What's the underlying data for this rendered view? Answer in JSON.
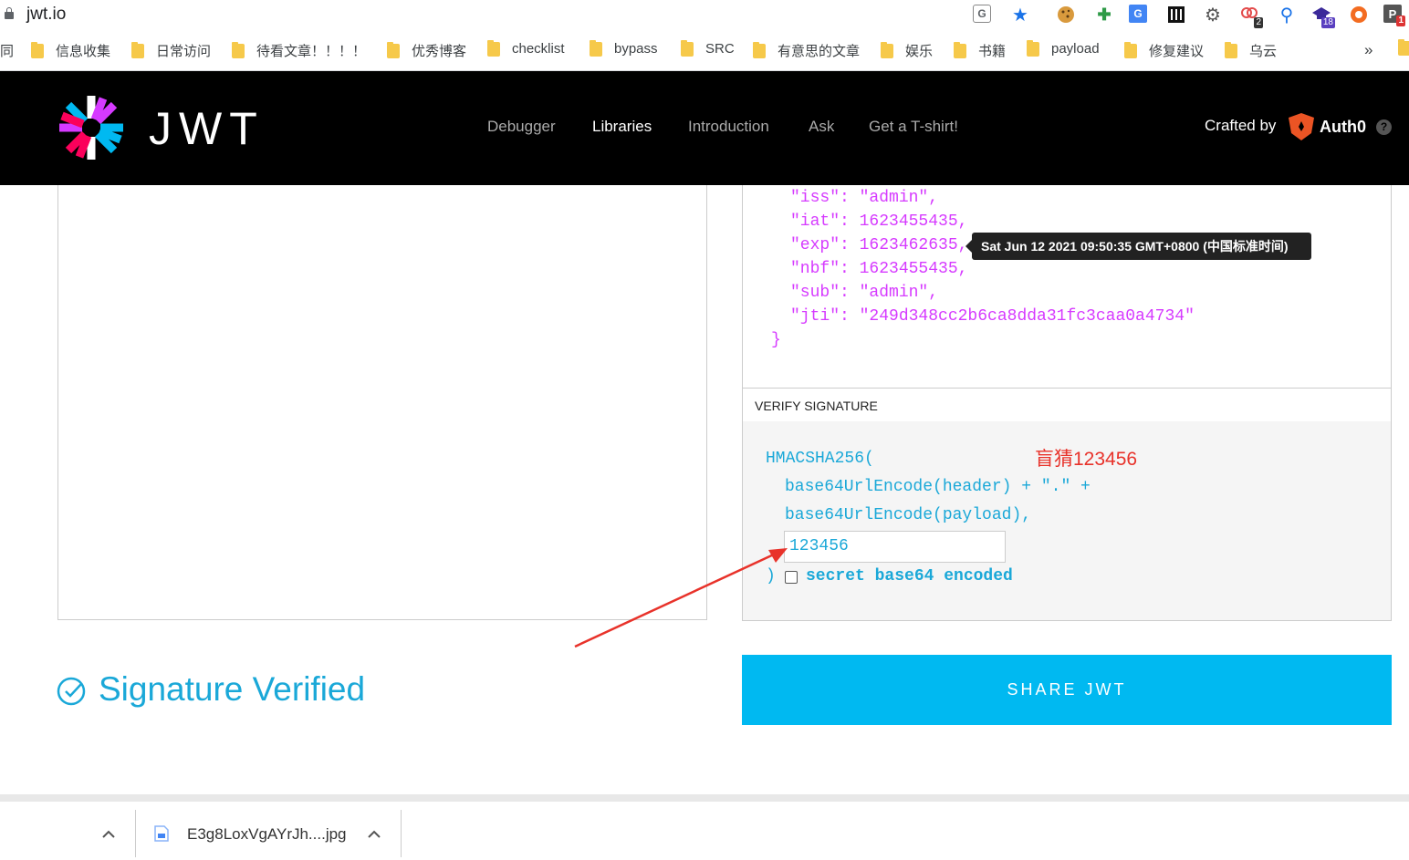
{
  "browser": {
    "url": "jwt.io",
    "extensions": [
      {
        "name": "translate-icon",
        "glyph": "G"
      },
      {
        "name": "star-icon",
        "glyph": "★"
      },
      {
        "name": "cookie-icon",
        "glyph": "🍪"
      },
      {
        "name": "plus-extension-icon",
        "glyph": "✚"
      },
      {
        "name": "google-translate-icon",
        "glyph": "G"
      },
      {
        "name": "columns-icon",
        "glyph": "▥"
      },
      {
        "name": "gear-extension-icon",
        "glyph": "⚙"
      },
      {
        "name": "links-extension-icon",
        "glyph": "∞",
        "badge": "2"
      },
      {
        "name": "pin-icon",
        "glyph": "⚲"
      },
      {
        "name": "cap-extension-icon",
        "glyph": "▲",
        "badge": "18"
      },
      {
        "name": "lifebuoy-icon",
        "glyph": "◎"
      },
      {
        "name": "p-extension-icon",
        "glyph": "P",
        "badge": "1"
      }
    ],
    "bookmarks": [
      "信息收集",
      "日常访问",
      "待看文章！！！！",
      "优秀博客",
      "checklist",
      "bypass",
      "SRC",
      "有意思的文章",
      "娱乐",
      "书籍",
      "payload",
      "修复建议",
      "乌云"
    ],
    "bookmark_partial": "同",
    "more": "»"
  },
  "header": {
    "logo_text": "JWT",
    "nav": [
      "Debugger",
      "Libraries",
      "Introduction",
      "Ask",
      "Get a T-shirt!"
    ],
    "crafted_by": "Crafted by",
    "auth0": "Auth0",
    "help": "?"
  },
  "payload": {
    "lines": [
      "\"iss\": \"admin\",",
      "\"iat\": 1623455435,",
      "\"exp\": 1623462635,",
      "\"nbf\": 1623455435,",
      "\"sub\": \"admin\",",
      "\"jti\": \"249d348cc2b6ca8dda31fc3caa0a4734\""
    ],
    "closing": "}",
    "tooltip": "Sat Jun 12 2021 09:50:35 GMT+0800 (中国标准时间)"
  },
  "verify": {
    "heading": "VERIFY SIGNATURE",
    "fn": "HMACSHA256(",
    "line2": "base64UrlEncode(header) + \".\" +",
    "line3": "base64UrlEncode(payload),",
    "secret": "123456",
    "close": ")",
    "b64_label": "secret base64 encoded",
    "annotation": "盲猜123456"
  },
  "status": {
    "signature": "Signature Verified",
    "share": "SHARE JWT"
  },
  "downloads": {
    "file": "E3g8LoxVgAYrJh....jpg"
  },
  "colors": {
    "accent": "#00b9f1",
    "payload_purple": "#d63aff",
    "annotation_red": "#e8322a"
  }
}
